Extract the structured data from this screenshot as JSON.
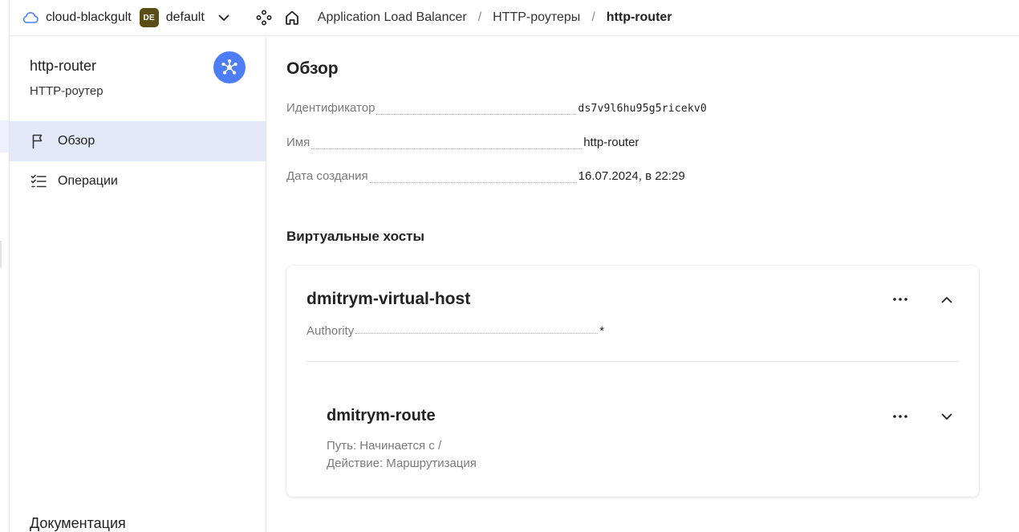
{
  "header": {
    "cloud_name": "cloud-blackgult",
    "folder_badge": "DE",
    "folder_name": "default",
    "breadcrumbs": [
      "Application Load Balancer",
      "HTTP-роутеры",
      "http-router"
    ],
    "crumb_separator": "/"
  },
  "sidebar": {
    "title": "http-router",
    "subtitle": "HTTP-роутер",
    "items": [
      {
        "label": "Обзор",
        "icon": "flag-icon",
        "active": true
      },
      {
        "label": "Операции",
        "icon": "checklist-icon",
        "active": false
      }
    ],
    "docs_label": "Документация"
  },
  "main": {
    "title": "Обзор",
    "properties": [
      {
        "key": "Идентификатор",
        "value": "ds7v9l6hu95g5ricekv0"
      },
      {
        "key": "Имя",
        "value": "http-router"
      },
      {
        "key": "Дата создания",
        "value": "16.07.2024, в 22:29"
      }
    ],
    "virtual_hosts_title": "Виртуальные хосты",
    "virtual_host": {
      "name": "dmitrym-virtual-host",
      "authority_key": "Authority",
      "authority_value": "*",
      "route": {
        "name": "dmitrym-route",
        "path": "Путь: Начинается с /",
        "action": "Действие: Маршрутизация"
      }
    }
  },
  "colors": {
    "accent": "#4d7ef7",
    "active_nav_bg": "#e3e9f8",
    "folder_badge_bg": "#5b4d16"
  }
}
